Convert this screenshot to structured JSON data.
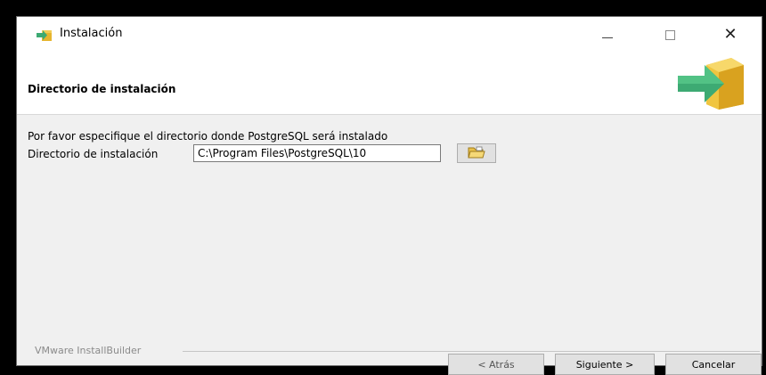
{
  "window": {
    "title": "Instalación"
  },
  "header": {
    "title": "Directorio de instalación"
  },
  "content": {
    "instruction": "Por favor especifique el directorio donde PostgreSQL será instalado",
    "directory_label": "Directorio de instalación",
    "directory_value": "C:\\Program Files\\PostgreSQL\\10"
  },
  "footer": {
    "brand": "VMware InstallBuilder",
    "back_label": "< Atrás",
    "next_label": "Siguiente >",
    "cancel_label": "Cancelar"
  },
  "icons": {
    "app": "installer-box-icon",
    "header_logo": "box-arrow-icon",
    "browse": "folder-open-icon"
  },
  "colors": {
    "arrow_green": "#3daa73",
    "box_gold": "#e6b52e"
  }
}
